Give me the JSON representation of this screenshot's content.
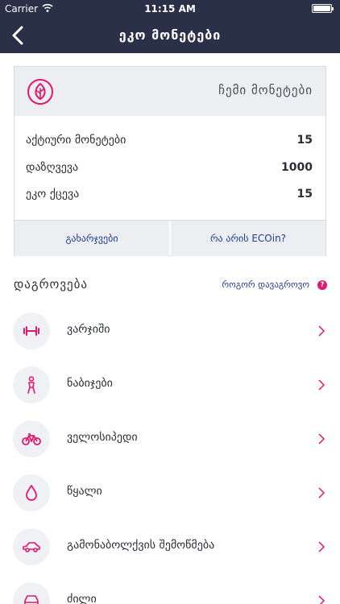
{
  "status_bar": {
    "carrier": "Carrier",
    "time": "11:15 AM"
  },
  "header": {
    "title": "ეკო მონეტები"
  },
  "coins_card": {
    "title": "ჩემი მონეტები",
    "stats": [
      {
        "label": "აქტიური მონეტები",
        "value": "15"
      },
      {
        "label": "დაზღვევა",
        "value": "1000"
      },
      {
        "label": "ეკო ქცევა",
        "value": "15"
      }
    ],
    "actions": {
      "spend_label": "გახარჯვები",
      "what_label": "რა არის ECOin?"
    }
  },
  "earning": {
    "title": "დაგროვება",
    "how_label": "როგორ დავაგროვო",
    "help_glyph": "?",
    "items": [
      {
        "label": "ვარჯიში",
        "icon": "dumbbell-icon"
      },
      {
        "label": "ნაბიჯები",
        "icon": "walking-person-icon"
      },
      {
        "label": "ველოსიპედი",
        "icon": "bicycle-icon"
      },
      {
        "label": "წყალი",
        "icon": "water-drop-icon"
      },
      {
        "label": "გამონაბოლქვის შემოწმება",
        "icon": "car-icon"
      },
      {
        "label": "ძილი",
        "icon": "car-front-icon"
      }
    ]
  },
  "colors": {
    "header_bg": "#2b3049",
    "accent": "#e0186f",
    "link": "#1f3b8f",
    "panel_bg": "#eceef1"
  }
}
